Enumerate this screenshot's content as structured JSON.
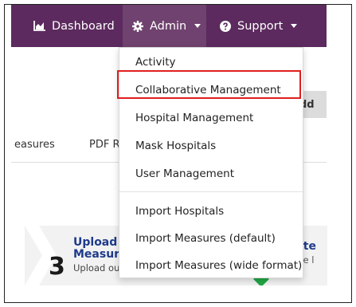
{
  "nav": {
    "dashboard_label": "Dashboard",
    "admin_label": "Admin",
    "support_label": "Support",
    "bar_color": "#5c2a5e",
    "active_color": "#70426f"
  },
  "admin_menu": {
    "items": [
      "Activity",
      "Collaborative Management",
      "Hospital Management",
      "Mask Hospitals",
      "User Management",
      "Import Hospitals",
      "Import Measures (default)",
      "Import Measures (wide format)"
    ],
    "highlighted_item": "Collaborative Management",
    "highlight_color": "#e01e1e"
  },
  "background": {
    "button_partial": "dd",
    "tab_partial_1": "easures",
    "tab_partial_2": "PDF R",
    "step": {
      "number": "3",
      "title": "Upload F Measure",
      "subtitle": "Upload ou",
      "right_title": "ite",
      "right_sub": "te l"
    }
  }
}
